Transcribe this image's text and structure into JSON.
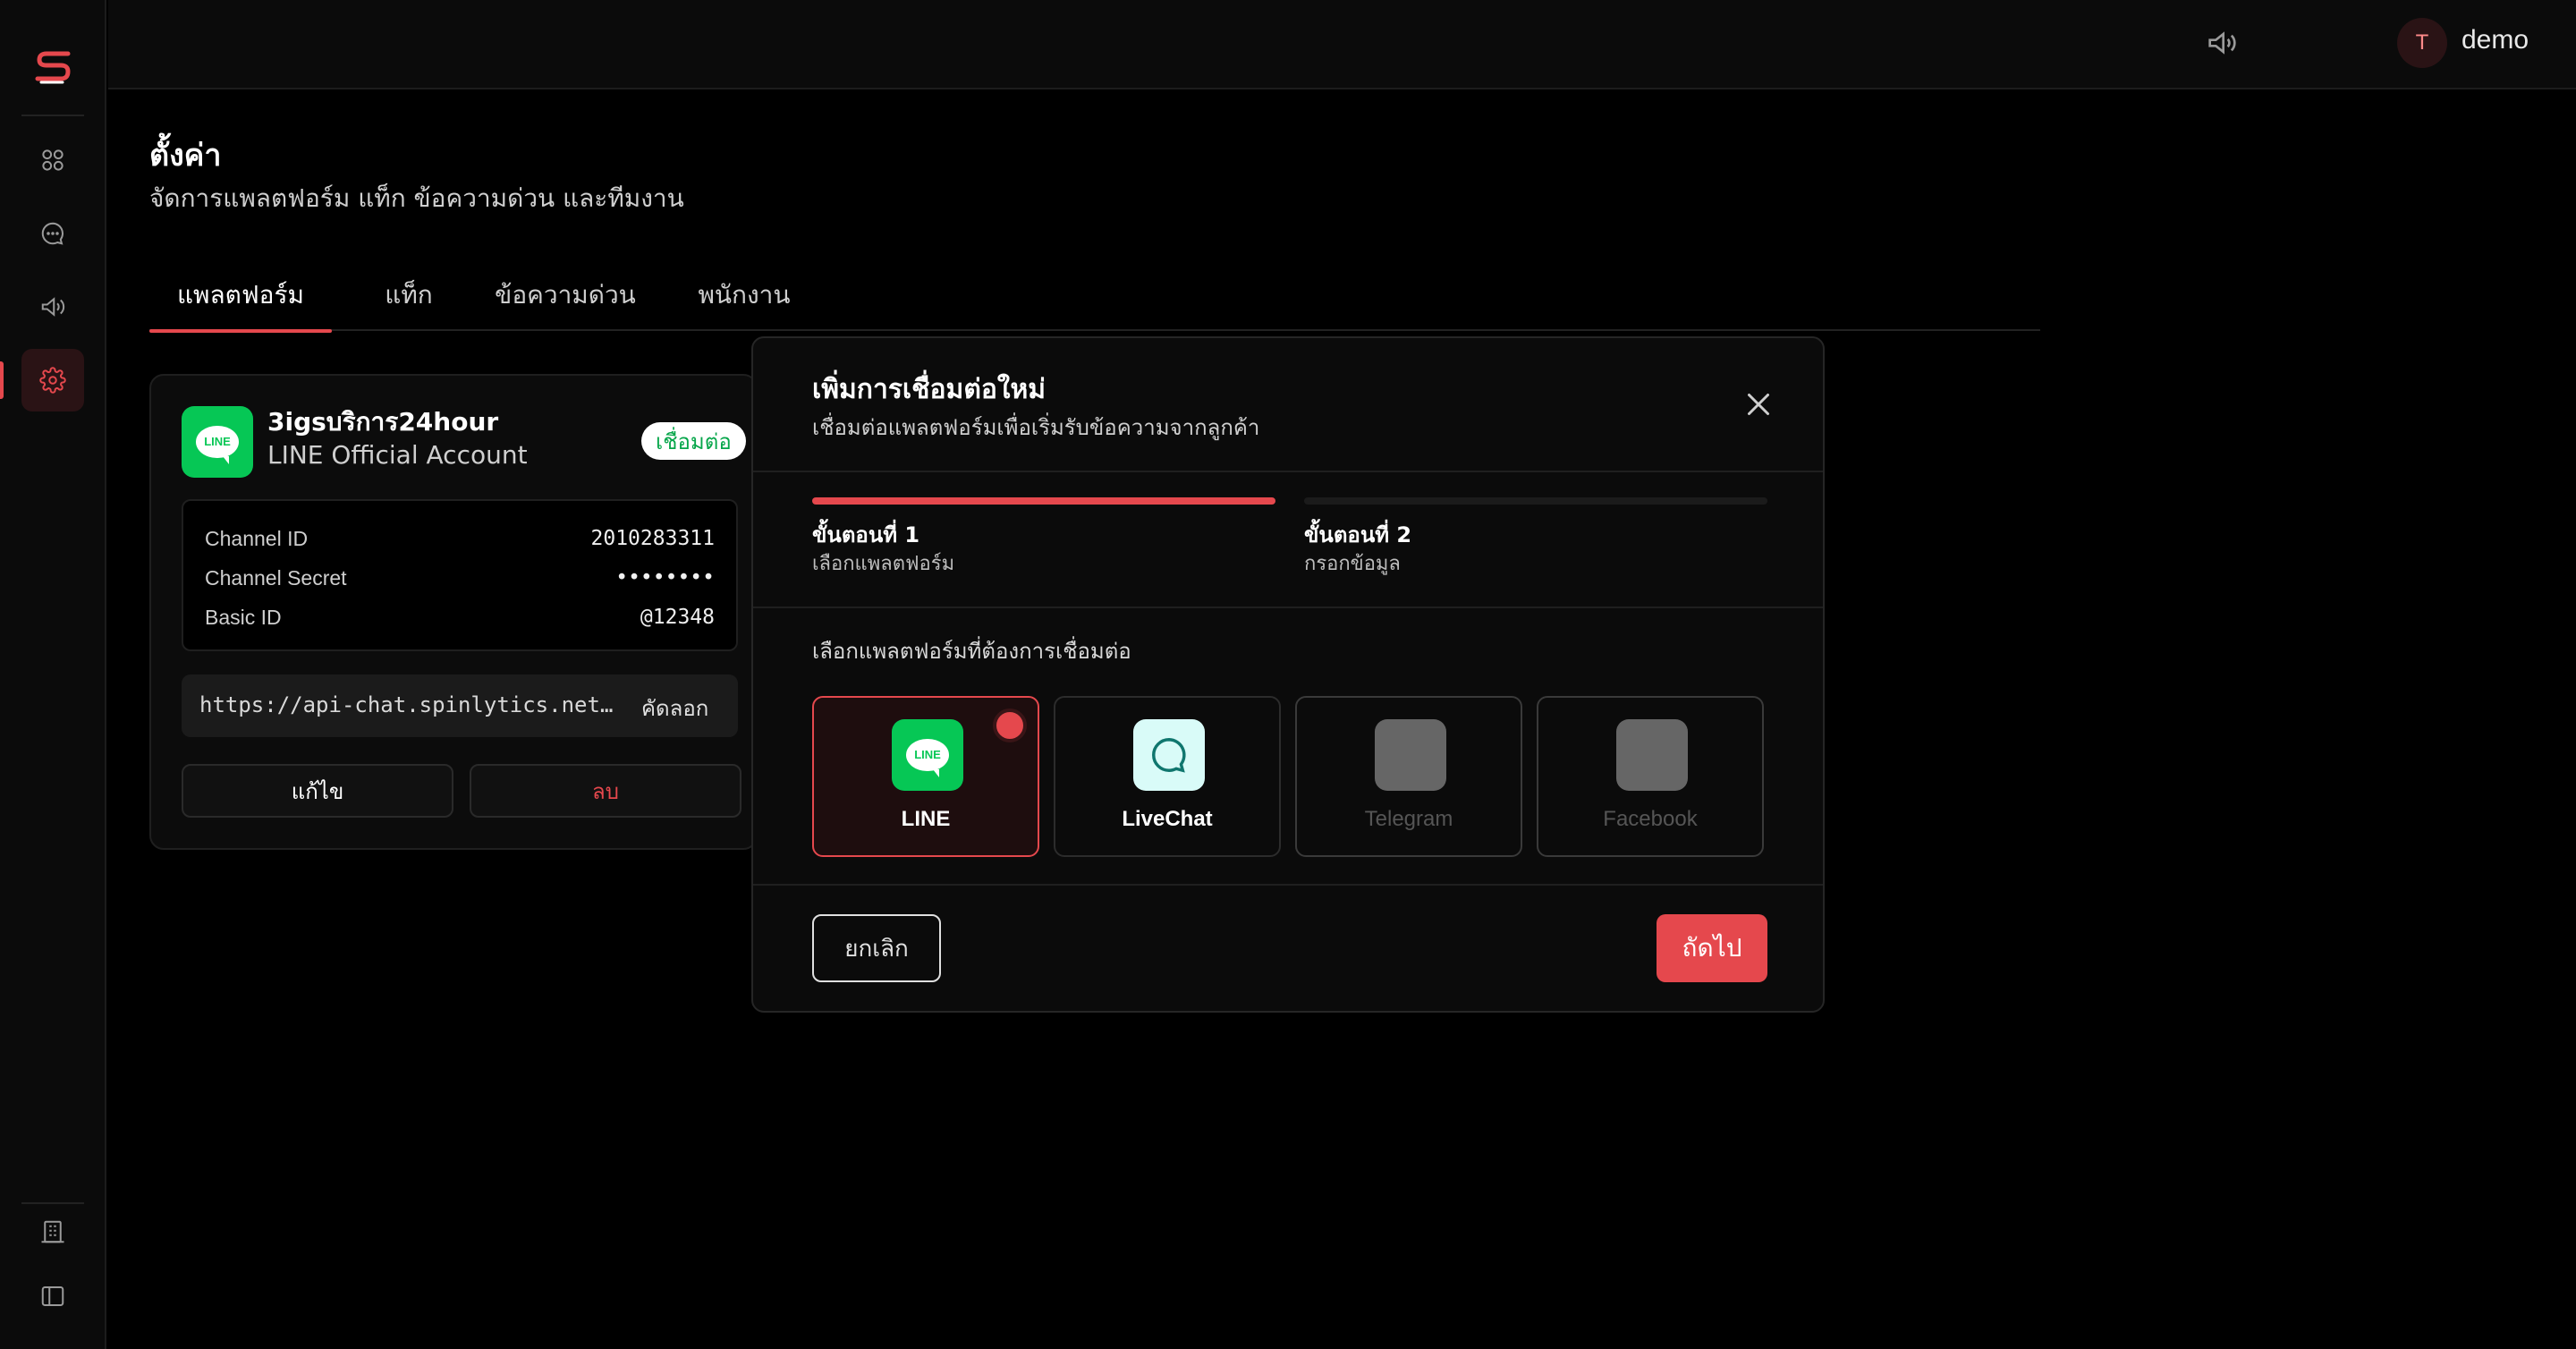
{
  "app": {
    "logo_text": "S",
    "accent_color": "#e5484d"
  },
  "sidebar": {
    "items": [
      {
        "name": "apps-grid-icon"
      },
      {
        "name": "chat-icon"
      },
      {
        "name": "megaphone-icon"
      },
      {
        "name": "gear-icon",
        "active": true
      }
    ],
    "bottom_items": [
      {
        "name": "building-icon"
      },
      {
        "name": "sidebar-toggle-icon"
      }
    ]
  },
  "topbar": {
    "user_initial": "T",
    "username": "demo"
  },
  "page": {
    "title": "ตั้งค่า",
    "subtitle": "จัดการแพลตฟอร์ม แท็ก ข้อความด่วน และทีมงาน",
    "tabs": [
      {
        "label": "แพลตฟอร์ม",
        "active": true
      },
      {
        "label": "แท็ก"
      },
      {
        "label": "ข้อความด่วน"
      },
      {
        "label": "พนักงาน"
      }
    ]
  },
  "card": {
    "logo_text": "LINE",
    "name": "3igsบริการ24hour",
    "type": "LINE Official Account",
    "status": "เชื่อมต่อ",
    "fields": [
      {
        "label": "Channel ID",
        "value": "2010283311"
      },
      {
        "label": "Channel Secret",
        "value": "••••••••"
      },
      {
        "label": "Basic ID",
        "value": "@12348"
      }
    ],
    "url": "https://api-chat.spinlytics.net/webhook/line",
    "copy_label": "คัดลอก",
    "edit_label": "แก้ไข",
    "delete_label": "ลบ"
  },
  "modal": {
    "title": "เพิ่มการเชื่อมต่อใหม่",
    "subtitle": "เชื่อมต่อแพลตฟอร์มเพื่อเริ่มรับข้อความจากลูกค้า",
    "steps": [
      {
        "title": "ขั้นตอนที่ 1",
        "desc": "เลือกแพลตฟอร์ม",
        "active": true
      },
      {
        "title": "ขั้นตอนที่ 2",
        "desc": "กรอกข้อมูล",
        "active": false
      }
    ],
    "select_label": "เลือกแพลตฟอร์มที่ต้องการเชื่อมต่อ",
    "platforms": [
      {
        "label": "LINE",
        "state": "selected",
        "color": "#06c755"
      },
      {
        "label": "LiveChat",
        "state": "enabled",
        "color": "#d9fbf8"
      },
      {
        "label": "Telegram",
        "state": "disabled",
        "color": "#666666"
      },
      {
        "label": "Facebook",
        "state": "disabled",
        "color": "#666666"
      }
    ],
    "cancel_label": "ยกเลิก",
    "next_label": "ถัดไป"
  }
}
